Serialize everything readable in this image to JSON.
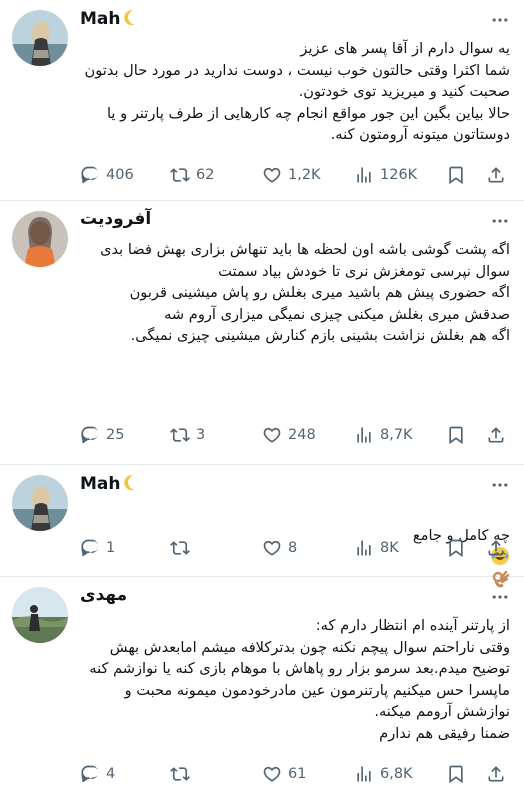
{
  "tweets": [
    {
      "author": "Mah",
      "author_emoji": "moon-icon",
      "text": "یه سوال دارم از آقا پسر های عزیز\nشما اکثرا وقتی حالتون خوب نیست ، دوست ندارید در مورد حال بدتون صحبت کنید و میریزید توی خودتون.\nحالا بیاین بگین این جور مواقع انجام چه کارهایی از طرف پارتنر و یا دوستاتون میتونه آرومتون کنه.",
      "replies": "406",
      "retweets": "62",
      "likes": "1,2K",
      "views": "126K"
    },
    {
      "author": "آفرودیت",
      "text": "اگه پشت گوشی باشه اون لحظه ها باید تنهاش بزاری بهش فضا بدی سوال نپرسی تومغزش نری تا خودش بیاد سمتت\nاگه حضوری پیش هم باشید میری بغلش رو پاش میشینی قربون صدقش میری بغلش میکنی چیزی نمیگی میزاری آروم شه\nاگه هم بغلش نزاشت بشینی بازم کنارش میشینی چیزی نمیگی.",
      "replies": "25",
      "retweets": "3",
      "likes": "248",
      "views": "8,7K"
    },
    {
      "author": "Mah",
      "author_emoji": "moon-icon",
      "text": "چه کامل و جامع",
      "text_emoji": "joy-ok-hand-icons",
      "replies": "1",
      "retweets": "",
      "likes": "8",
      "views": "8K"
    },
    {
      "author": "مهدی",
      "text": "از پارتنر آینده ام انتظار دارم که:\nوقتی ناراحتم سوال پیچم نکنه چون بدترکلافه میشم امابعدش بهش توضیح میدم.بعد سرمو بزار رو پاهاش با موهام بازی کنه یا نوازشم کنه ماپسرا حس میکنیم پارتنرمون عین مادرخودمون میمونه محبت و نوازشش آرومم میکنه.\nضمنا رفیقی هم ندارم",
      "replies": "4",
      "retweets": "",
      "likes": "61",
      "views": "6,8K"
    }
  ],
  "colors": {
    "text": "#0f1419",
    "muted": "#536471",
    "divider": "#e6e9ec",
    "moon": "#f5c33b"
  }
}
